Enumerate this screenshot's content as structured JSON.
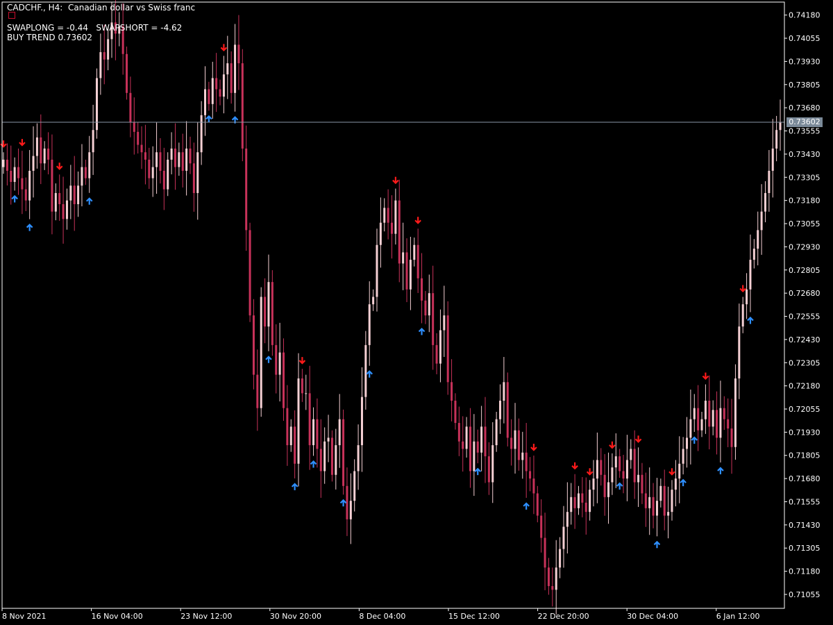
{
  "header": {
    "title": "CADCHF., H4:  Canadian dollar vs Swiss franc",
    "swap_line": "SWAPLONG = -0.44   SWAPSHORT = -4.62",
    "trend_line": "BUY TREND 0.73602"
  },
  "colors": {
    "background": "#000000",
    "axis": "#ffffff",
    "bull_candle": "#f5d0d4",
    "bear_candle": "#c8325a",
    "sell_arrow": "#ff1a1a",
    "buy_arrow": "#2e8fff",
    "price_line": "#8a98a8",
    "price_tag": "#7b8a99"
  },
  "chart_data": {
    "type": "candlestick",
    "symbol": "CADCHF.",
    "timeframe": "H4",
    "current_price": 0.73602,
    "current_price_label": "0.73602",
    "ylim": [
      0.7098,
      0.7425
    ],
    "y_ticks": [
      "0.74180",
      "0.74055",
      "0.73930",
      "0.73805",
      "0.73680",
      "0.73555",
      "0.73430",
      "0.73305",
      "0.73180",
      "0.73055",
      "0.72930",
      "0.72805",
      "0.72680",
      "0.72555",
      "0.72430",
      "0.72305",
      "0.72180",
      "0.72055",
      "0.71930",
      "0.71805",
      "0.71680",
      "0.71555",
      "0.71430",
      "0.71305",
      "0.71180",
      "0.71055"
    ],
    "x_ticks": [
      "8 Nov 2021",
      "16 Nov 04:00",
      "23 Nov 12:00",
      "30 Nov 20:00",
      "8 Dec 04:00",
      "15 Dec 12:00",
      "22 Dec 20:00",
      "30 Dec 04:00",
      "6 Jan 12:00"
    ],
    "closes": [
      0.734,
      0.7334,
      0.7328,
      0.7336,
      0.733,
      0.7324,
      0.7318,
      0.7334,
      0.7342,
      0.7352,
      0.7338,
      0.7346,
      0.734,
      0.7312,
      0.7322,
      0.7316,
      0.7308,
      0.7318,
      0.7326,
      0.7316,
      0.7326,
      0.7336,
      0.733,
      0.7344,
      0.7356,
      0.7384,
      0.7398,
      0.7394,
      0.7405,
      0.7414,
      0.7408,
      0.7412,
      0.7397,
      0.7376,
      0.736,
      0.7355,
      0.7348,
      0.7344,
      0.734,
      0.733,
      0.7336,
      0.7344,
      0.7334,
      0.7324,
      0.734,
      0.7346,
      0.7336,
      0.7344,
      0.7334,
      0.7346,
      0.7338,
      0.7322,
      0.7344,
      0.7364,
      0.7378,
      0.737,
      0.7384,
      0.7378,
      0.7374,
      0.7386,
      0.7392,
      0.7376,
      0.7402,
      0.7392,
      0.7346,
      0.7302,
      0.7256,
      0.7224,
      0.7206,
      0.7266,
      0.725,
      0.7274,
      0.724,
      0.7224,
      0.7236,
      0.7206,
      0.7186,
      0.7196,
      0.7176,
      0.7222,
      0.7214,
      0.7214,
      0.7186,
      0.72,
      0.7184,
      0.7172,
      0.7188,
      0.719,
      0.717,
      0.7186,
      0.72,
      0.7164,
      0.7146,
      0.7156,
      0.7172,
      0.7186,
      0.7212,
      0.724,
      0.7262,
      0.7266,
      0.7294,
      0.7306,
      0.7314,
      0.7306,
      0.73,
      0.7318,
      0.7284,
      0.729,
      0.727,
      0.7286,
      0.7294,
      0.7276,
      0.7264,
      0.7256,
      0.7268,
      0.724,
      0.723,
      0.7248,
      0.7256,
      0.722,
      0.721,
      0.7198,
      0.7188,
      0.7184,
      0.7196,
      0.7172,
      0.7188,
      0.7182,
      0.7196,
      0.718,
      0.7166,
      0.7186,
      0.72,
      0.721,
      0.722,
      0.719,
      0.7184,
      0.7194,
      0.7178,
      0.7182,
      0.7172,
      0.7168,
      0.716,
      0.7148,
      0.7136,
      0.712,
      0.711,
      0.7108,
      0.712,
      0.713,
      0.7142,
      0.715,
      0.7158,
      0.7152,
      0.716,
      0.7155,
      0.715,
      0.7162,
      0.7168,
      0.7178,
      0.717,
      0.7158,
      0.7166,
      0.7174,
      0.718,
      0.7172,
      0.7168,
      0.7178,
      0.7184,
      0.7166,
      0.717,
      0.716,
      0.7152,
      0.7158,
      0.7148,
      0.7156,
      0.7164,
      0.7148,
      0.715,
      0.7162,
      0.7168,
      0.7176,
      0.7184,
      0.719,
      0.72,
      0.7206,
      0.7194,
      0.72,
      0.721,
      0.7196,
      0.7205,
      0.719,
      0.7206,
      0.72,
      0.7195,
      0.7185,
      0.7222,
      0.725,
      0.7262,
      0.727,
      0.7286,
      0.7292,
      0.7302,
      0.7312,
      0.7322,
      0.7334,
      0.7346,
      0.7356,
      0.736
    ],
    "sell_signals": [
      0,
      5,
      15,
      59,
      80,
      105,
      111,
      142,
      153,
      157,
      163,
      170,
      179,
      188,
      198
    ],
    "buy_signals": [
      3,
      7,
      23,
      55,
      62,
      71,
      78,
      83,
      91,
      98,
      112,
      127,
      140,
      165,
      175,
      182,
      185,
      192,
      200
    ]
  }
}
